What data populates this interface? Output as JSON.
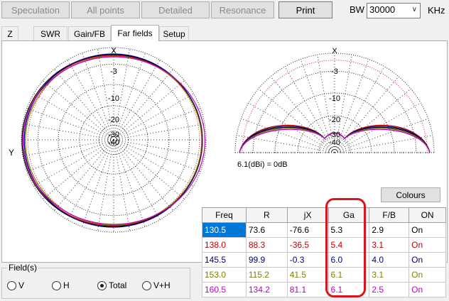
{
  "toolbar": {
    "speculation": "Speculation",
    "all_points": "All points",
    "detailed": "Detailed",
    "resonance": "Resonance",
    "print": "Print",
    "bw_label": "BW",
    "bw_value": "30000",
    "khz": "KHz"
  },
  "tabs": [
    "Z",
    "SWR",
    "Gain/FB",
    "Far fields",
    "Setup"
  ],
  "active_tab": "Far fields",
  "horizontal_plot": {
    "x_label": "X",
    "y_label": "Y",
    "ring_labels": [
      "-3",
      "-10",
      "-20",
      "-30",
      "-40"
    ]
  },
  "vertical_plot": {
    "x_label": "X",
    "ring_labels": [
      "-3",
      "-10",
      "-20",
      "-30",
      "-40"
    ],
    "caption": "6.1(dBi) = 0dB"
  },
  "colours_button": "Colours",
  "table": {
    "headers": [
      "Freq",
      "R",
      "jX",
      "Ga",
      "F/B",
      "ON"
    ],
    "rows": [
      {
        "freq": "130.5",
        "r": "73.6",
        "jx": "-76.6",
        "ga": "5.3",
        "fb": "2.9",
        "on": "On",
        "color": "#000000"
      },
      {
        "freq": "138.0",
        "r": "88.3",
        "jx": "-36.5",
        "ga": "5.4",
        "fb": "3.1",
        "on": "On",
        "color": "#c00000"
      },
      {
        "freq": "145.5",
        "r": "99.9",
        "jx": "-0.3",
        "ga": "6.0",
        "fb": "4.0",
        "on": "On",
        "color": "#00007f"
      },
      {
        "freq": "153.0",
        "r": "115.2",
        "jx": "41.5",
        "ga": "6.1",
        "fb": "3.1",
        "on": "On",
        "color": "#808000"
      },
      {
        "freq": "160.5",
        "r": "134.2",
        "jx": "81.1",
        "ga": "6.1",
        "fb": "2.5",
        "on": "On",
        "color": "#c000c0"
      }
    ]
  },
  "field": {
    "legend": "Field(s)",
    "options": [
      "V",
      "H",
      "Total",
      "V+H"
    ],
    "selected": "Total"
  },
  "colors": {
    "highlight": "#d9141c",
    "selection": "#0078d7",
    "trace_black": "#000000",
    "trace_red": "#c00000",
    "trace_blue": "#00007f",
    "trace_olive": "#808000",
    "trace_magenta": "#c000c0"
  }
}
